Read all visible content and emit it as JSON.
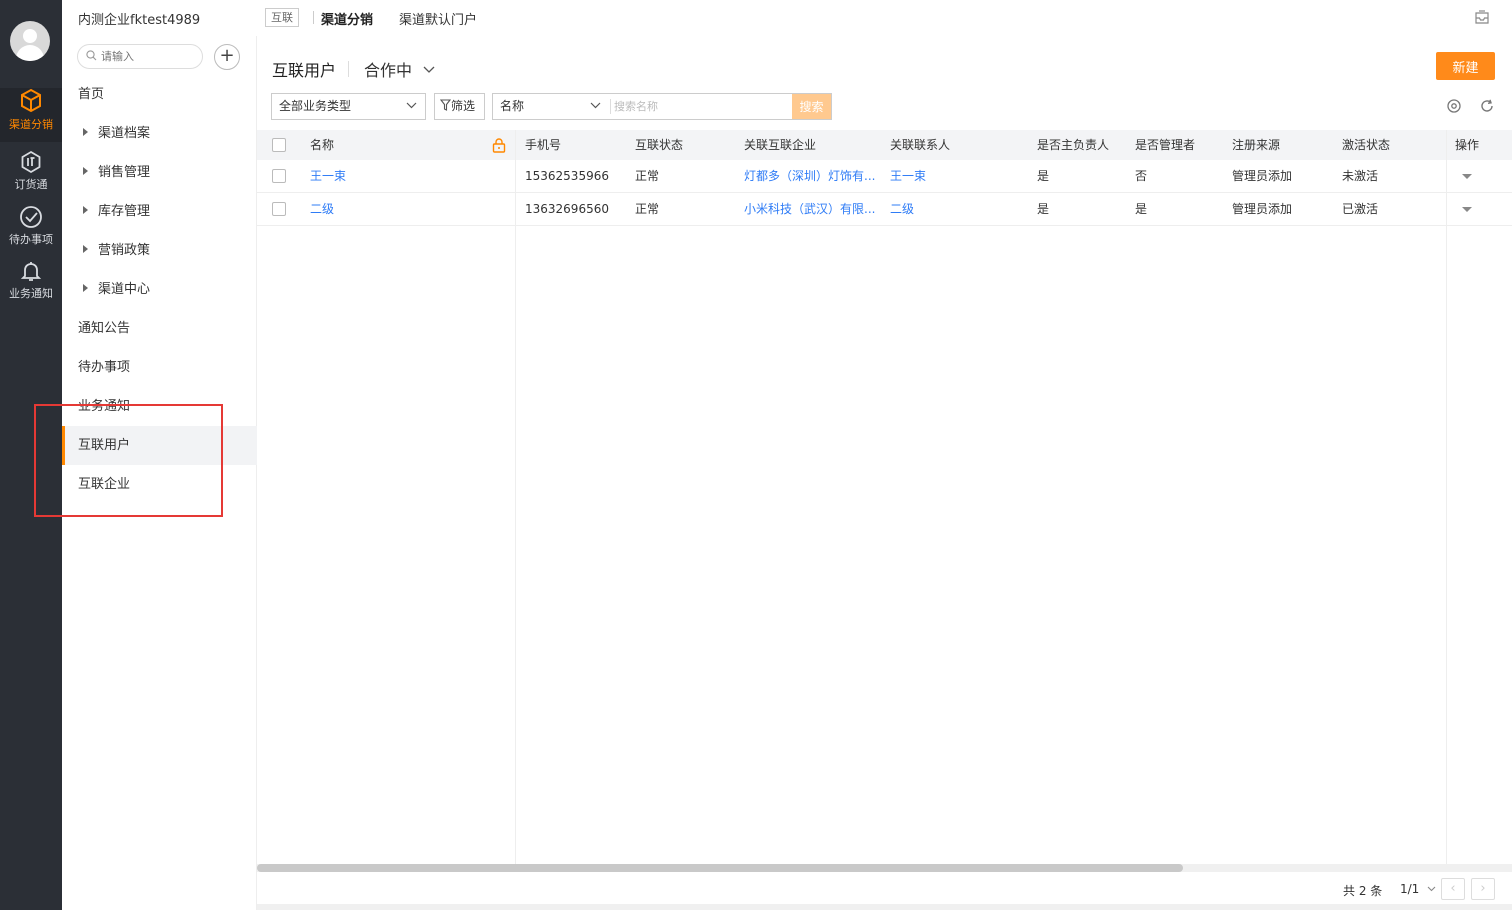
{
  "rail": {
    "items": [
      {
        "label": "渠道分销",
        "icon": "cube-icon",
        "active": true
      },
      {
        "label": "订货通",
        "icon": "order-icon"
      },
      {
        "label": "待办事项",
        "icon": "check-circle-icon"
      },
      {
        "label": "业务通知",
        "icon": "bell-icon"
      }
    ]
  },
  "topbar": {
    "company": "内测企业fktest4989",
    "tag": "互联",
    "link1": "渠道分销",
    "link2": "渠道默认门户"
  },
  "sidenav": {
    "search_placeholder": "请输入",
    "add": "+",
    "items": [
      {
        "label": "首页"
      },
      {
        "label": "渠道档案"
      },
      {
        "label": "销售管理"
      },
      {
        "label": "库存管理"
      },
      {
        "label": "营销政策"
      },
      {
        "label": "渠道中心"
      },
      {
        "label": "通知公告"
      },
      {
        "label": "待办事项"
      },
      {
        "label": "业务通知"
      },
      {
        "label": "互联用户"
      },
      {
        "label": "互联企业"
      }
    ]
  },
  "main": {
    "title": "互联用户",
    "status_filter": "合作中",
    "new_button": "新建",
    "type_select": "全部业务类型",
    "filter_button": "筛选",
    "field_select": "名称",
    "search_placeholder": "搜索名称",
    "search_button": "搜索"
  },
  "table": {
    "headers": [
      "名称",
      "手机号",
      "互联状态",
      "关联互联企业",
      "关联联系人",
      "是否主负责人",
      "是否管理者",
      "注册来源",
      "激活状态",
      "操作"
    ],
    "rows": [
      [
        "王一束",
        "15362535966",
        "正常",
        "灯都多（深圳）灯饰有...",
        "王一束",
        "是",
        "否",
        "管理员添加",
        "未激活"
      ],
      [
        "二级",
        "13632696560",
        "正常",
        "小米科技（武汉）有限...",
        "二级",
        "是",
        "是",
        "管理员添加",
        "已激活"
      ]
    ]
  },
  "footer": {
    "total": "共 2 条",
    "page": "1/1",
    "prev": "‹",
    "next": "›"
  },
  "colors": {
    "accent": "#ff8800",
    "link": "#2f7cf6",
    "rail_bg": "#2b2f36",
    "highlight": "#e53935"
  }
}
